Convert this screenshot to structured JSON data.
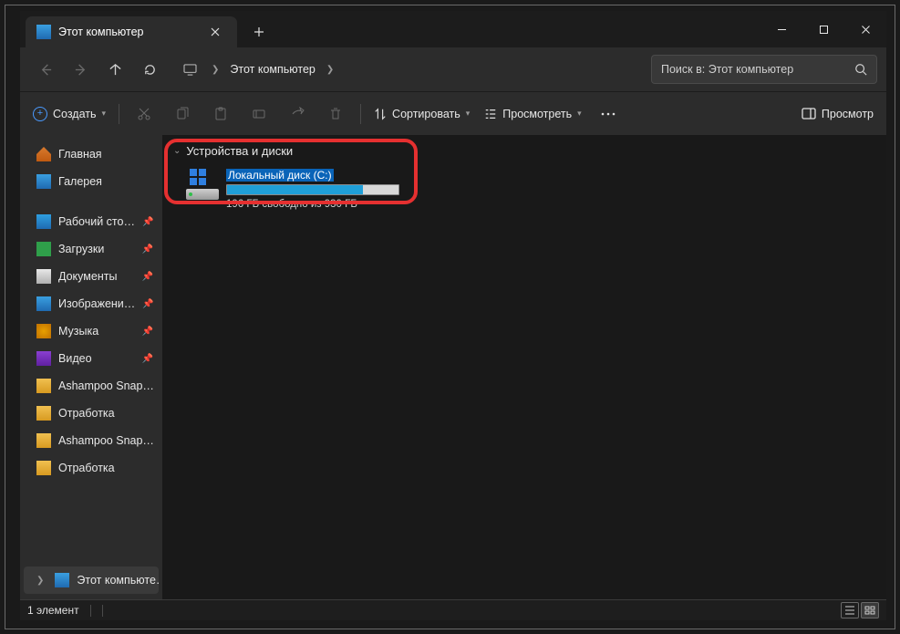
{
  "tab": {
    "title": "Этот компьютер"
  },
  "breadcrumb": {
    "location": "Этот компьютер"
  },
  "search": {
    "placeholder": "Поиск в: Этот компьютер"
  },
  "toolbar": {
    "new": "Создать",
    "sort": "Сортировать",
    "view": "Просмотреть",
    "preview": "Просмотр"
  },
  "sidebar": {
    "home": "Главная",
    "gallery": "Галерея",
    "desktop": "Рабочий сто…",
    "downloads": "Загрузки",
    "documents": "Документы",
    "pictures": "Изображени…",
    "music": "Музыка",
    "videos": "Видео",
    "f1": "Ashampoo Snap…",
    "f2": "Отработка",
    "f3": "Ashampoo Snap…",
    "f4": "Отработка",
    "thispc": "Этот компьюте…"
  },
  "content": {
    "group": "Устройства и диски",
    "drive_name": "Локальный диск (C:)",
    "drive_free": "196 ГБ свободно из 930 ГБ",
    "used_percent": 79
  },
  "status": {
    "count": "1 элемент"
  }
}
